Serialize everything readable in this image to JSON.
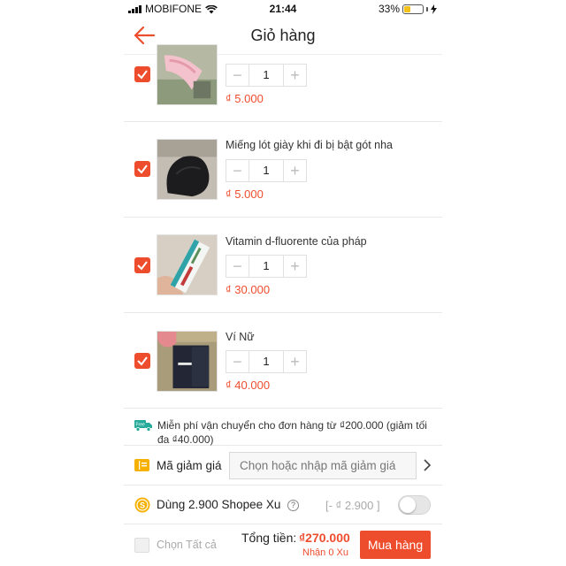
{
  "status_bar": {
    "carrier": "MOBIFONE",
    "time": "21:44",
    "battery": "33%"
  },
  "header": {
    "title": "Giỏ hàng",
    "back_icon": "arrow-left-icon"
  },
  "colors": {
    "accent": "#ee4d2d"
  },
  "cart": {
    "items": [
      {
        "name": "",
        "quantity": "1",
        "price": "₫ 5.000",
        "checked": true
      },
      {
        "name": "Miếng lót giày khi đi bị bật gót nha",
        "quantity": "1",
        "price": "₫ 5.000",
        "checked": true
      },
      {
        "name": "Vitamin d-fluorente của pháp",
        "quantity": "1",
        "price": "₫ 30.000",
        "checked": true
      },
      {
        "name": "Ví Nữ",
        "quantity": "1",
        "price": "₫ 40.000",
        "checked": true
      }
    ]
  },
  "shipping": {
    "text": "Miễn phí vận chuyển cho đơn hàng từ ₫200.000 (giảm tối đa ₫40.000)",
    "icon": "free-shipping-truck-icon"
  },
  "voucher": {
    "label": "Mã giảm giá",
    "placeholder": "Chọn hoặc nhập mã giảm giá"
  },
  "coins": {
    "label": "Dùng 2.900 Shopee Xu",
    "help": "?",
    "discount": "[- ₫ 2.900 ]",
    "enabled": false
  },
  "footer": {
    "select_all": "Chọn Tất cả",
    "total_label": "Tổng tiền:",
    "total_value": "₫270.000",
    "coins_earned": "Nhận 0 Xu",
    "buy_label": "Mua hàng"
  }
}
